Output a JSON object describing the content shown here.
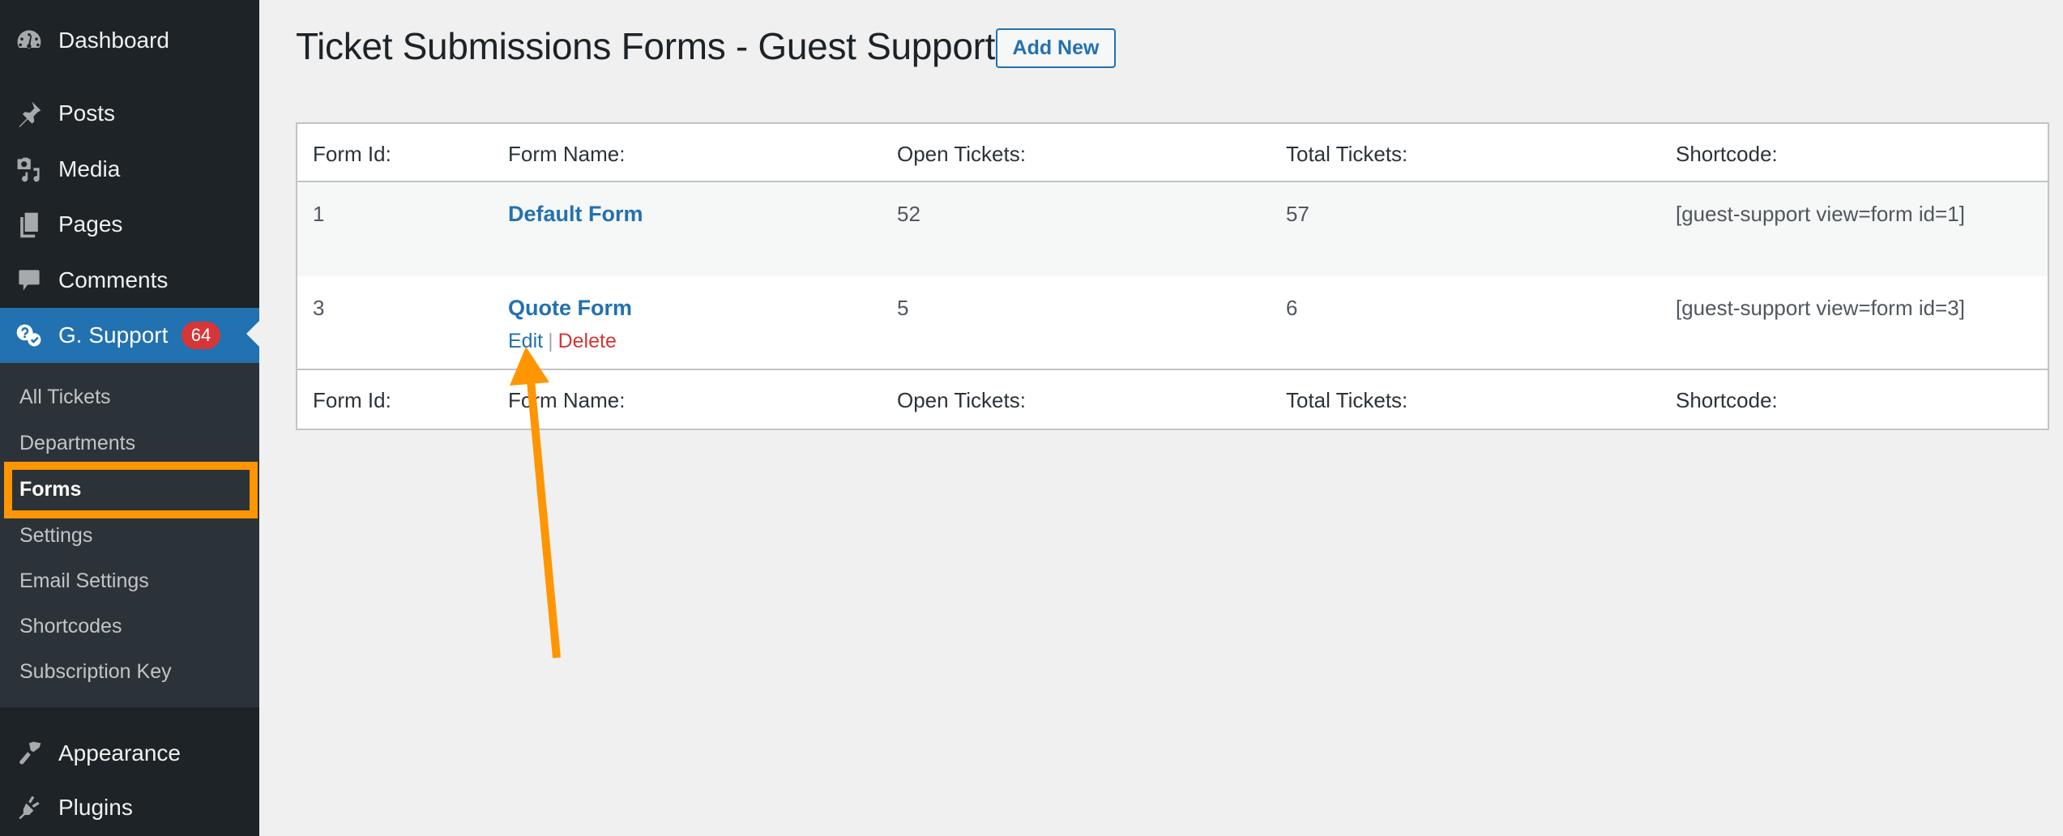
{
  "sidebar": {
    "items": [
      {
        "label": "Dashboard",
        "icon": "dashboard-icon"
      },
      {
        "label": "Posts",
        "icon": "pin-icon"
      },
      {
        "label": "Media",
        "icon": "media-icon"
      },
      {
        "label": "Pages",
        "icon": "pages-icon"
      },
      {
        "label": "Comments",
        "icon": "comment-icon"
      },
      {
        "label": "G. Support",
        "icon": "support-icon",
        "badge": "64",
        "current": true
      },
      {
        "label": "Appearance",
        "icon": "paintbrush-icon"
      },
      {
        "label": "Plugins",
        "icon": "plugin-icon"
      }
    ],
    "submenu": [
      {
        "label": "All Tickets"
      },
      {
        "label": "Departments"
      },
      {
        "label": "Forms",
        "current": true
      },
      {
        "label": "Settings"
      },
      {
        "label": "Email Settings"
      },
      {
        "label": "Shortcodes"
      },
      {
        "label": "Subscription Key"
      }
    ]
  },
  "main": {
    "title": "Ticket Submissions Forms - Guest Support",
    "add_new_label": "Add New",
    "table": {
      "columns": [
        "Form Id:",
        "Form Name:",
        "Open Tickets:",
        "Total Tickets:",
        "Shortcode:"
      ],
      "rows": [
        {
          "id": "1",
          "name": "Default Form",
          "open": "52",
          "total": "57",
          "shortcode": "[guest-support view=form id=1]"
        },
        {
          "id": "3",
          "name": "Quote Form",
          "open": "5",
          "total": "6",
          "shortcode": "[guest-support view=form id=3]",
          "actions": {
            "edit": "Edit",
            "separator": "|",
            "delete": "Delete"
          }
        }
      ]
    }
  },
  "annotation": {
    "color": "#ff9500",
    "highlight": "Forms",
    "arrow_target": "Edit"
  },
  "colors": {
    "sidebar_bg": "#1d2327",
    "submenu_bg": "#2c3338",
    "accent": "#2271b1",
    "badge": "#d63638",
    "delete": "#d63638"
  }
}
